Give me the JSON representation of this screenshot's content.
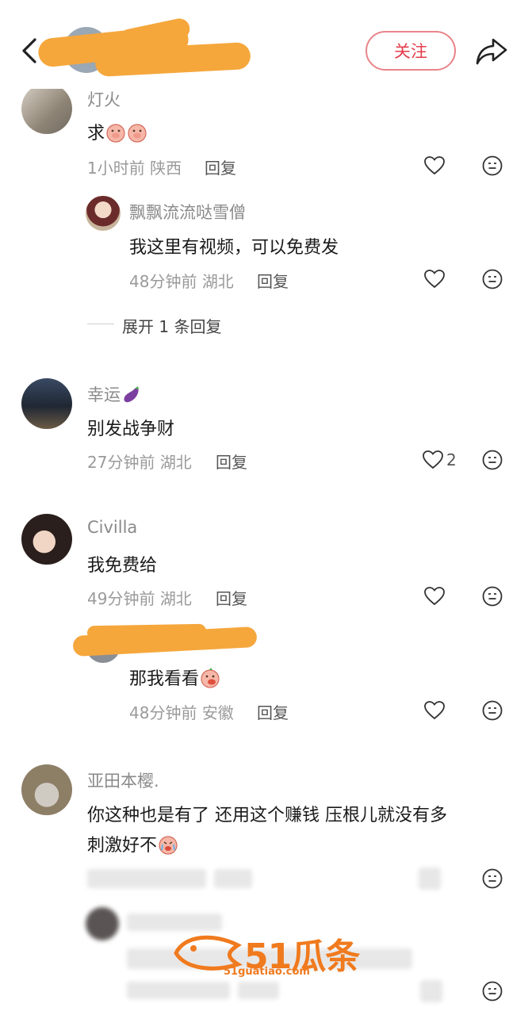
{
  "header": {
    "follow_label": "关注"
  },
  "comments": [
    {
      "username": "灯火",
      "text": "求",
      "time": "1小时前",
      "location": "陕西",
      "reply_label": "回复",
      "replies": [
        {
          "username": "飘飘流流哒雪僧",
          "text": "我这里有视频，可以免费发",
          "time": "48分钟前",
          "location": "湖北",
          "reply_label": "回复"
        }
      ],
      "expand_label": "展开 1 条回复"
    },
    {
      "username": "幸运",
      "text": "别发战争财",
      "time": "27分钟前",
      "location": "湖北",
      "reply_label": "回复",
      "like_count": "2"
    },
    {
      "username": "Civilla",
      "text": "我免费给",
      "time": "49分钟前",
      "location": "湖北",
      "reply_label": "回复",
      "replies": [
        {
          "text": "那我看看",
          "time": "48分钟前",
          "location": "安徽",
          "reply_label": "回复"
        }
      ]
    },
    {
      "username": "亚田本樱.",
      "text_line1": "你这种也是有了 还用这个赚钱 压根儿就没有多",
      "text_line2": "刺激好不"
    }
  ],
  "watermark": {
    "number": "51瓜条",
    "url": "51guatiao.com"
  },
  "colors": {
    "accent": "#e43d4b",
    "scribble": "#f5a73c",
    "watermark": "#f07a1e"
  }
}
